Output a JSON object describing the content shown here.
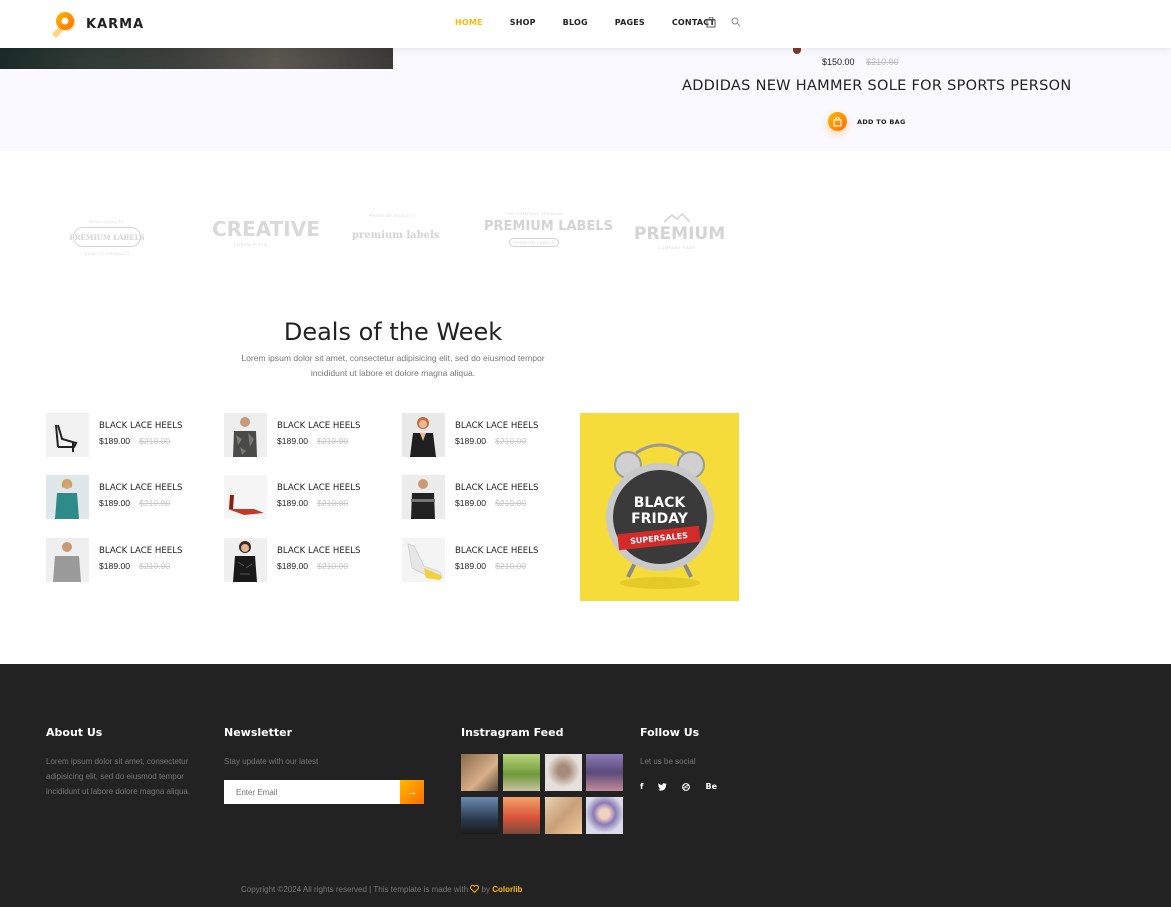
{
  "header": {
    "brand": "KARMA",
    "nav": [
      {
        "label": "HOME",
        "active": true
      },
      {
        "label": "SHOP",
        "active": false
      },
      {
        "label": "BLOG",
        "active": false
      },
      {
        "label": "PAGES",
        "active": false
      },
      {
        "label": "CONTACT",
        "active": false
      }
    ],
    "icons": [
      "bag-icon",
      "search-icon"
    ]
  },
  "hero": {
    "price": "$150.00",
    "old_price": "$210.00",
    "title": "ADDIDAS NEW HAMMER SOLE FOR SPORTS PERSON",
    "add_to_bag": "ADD TO BAG"
  },
  "brands": [
    {
      "top": "HIGH QUALITY",
      "main": "PREMIUM LABELS",
      "bottom": "QUALITY PRODUCT"
    },
    {
      "top": "",
      "main": "CREATIVE",
      "bottom": "LOREM IPSUM"
    },
    {
      "top": "PREMIUM QUALITY",
      "main": "premium labels",
      "bottom": ""
    },
    {
      "top": "THE COMPANY PREMIUM",
      "main": "PREMIUM LABELS",
      "bottom": "PREMIUM LABELS"
    },
    {
      "top": "",
      "main": "PREMIUM",
      "bottom": "COMPANY NAME"
    }
  ],
  "deals": {
    "title": "Deals of the Week",
    "subtitle": "Lorem ipsum dolor sit amet, consectetur adipisicing elit, sed do eiusmod tempor incididunt ut labore et dolore magna aliqua.",
    "products": [
      {
        "name": "BLACK LACE HEELS",
        "price": "$189.00",
        "old_price": "$210.00",
        "thumb": "heels-black"
      },
      {
        "name": "BLACK LACE HEELS",
        "price": "$189.00",
        "old_price": "$210.00",
        "thumb": "man-camo-shirt"
      },
      {
        "name": "BLACK LACE HEELS",
        "price": "$189.00",
        "old_price": "$210.00",
        "thumb": "woman-black-dress"
      },
      {
        "name": "BLACK LACE HEELS",
        "price": "$189.00",
        "old_price": "$210.00",
        "thumb": "woman-teal-top"
      },
      {
        "name": "BLACK LACE HEELS",
        "price": "$189.00",
        "old_price": "$210.00",
        "thumb": "red-flats"
      },
      {
        "name": "BLACK LACE HEELS",
        "price": "$189.00",
        "old_price": "$210.00",
        "thumb": "man-black-tshirt"
      },
      {
        "name": "BLACK LACE HEELS",
        "price": "$189.00",
        "old_price": "$210.00",
        "thumb": "man-grey-sweater"
      },
      {
        "name": "BLACK LACE HEELS",
        "price": "$189.00",
        "old_price": "$210.00",
        "thumb": "woman-black-blouse"
      },
      {
        "name": "BLACK LACE HEELS",
        "price": "$189.00",
        "old_price": "$210.00",
        "thumb": "yellow-heels"
      }
    ],
    "banner": {
      "line1": "BLACK",
      "line2": "FRIDAY",
      "ribbon": "SUPERSALES"
    }
  },
  "footer": {
    "about": {
      "title": "About Us",
      "text": "Lorem ipsum dolor sit amet, consectetur adipisicing elit, sed do eiusmod tempor incididunt ut labore dolore magna aliqua."
    },
    "newsletter": {
      "title": "Newsletter",
      "text": "Stay update with our latest",
      "placeholder": "Enter Email",
      "button": "→"
    },
    "instagram": {
      "title": "Instragram Feed"
    },
    "follow": {
      "title": "Follow Us",
      "text": "Let us be social",
      "networks": [
        "f",
        "twitter",
        "dribbble",
        "Be"
      ]
    },
    "copyright": {
      "text": "Copyright ©2024 All rights reserved | This template is made with",
      "by": "by",
      "brand": "Colorlib"
    }
  },
  "colors": {
    "accent": "#ffba00",
    "accent2": "#ff6c00",
    "footer_bg": "#222222",
    "hero_bg": "#f9f9ff"
  }
}
